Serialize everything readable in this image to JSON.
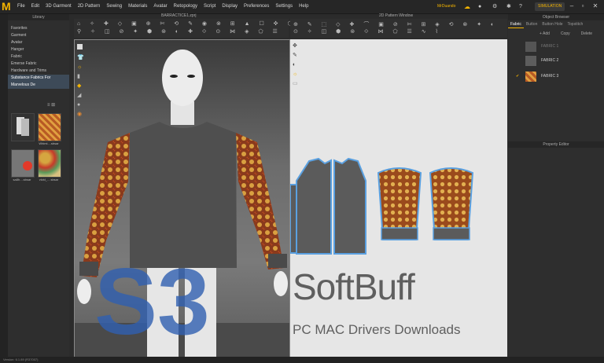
{
  "menu": [
    "File",
    "Edit",
    "3D Garment",
    "2D Pattern",
    "Sewing",
    "Materials",
    "Avatar",
    "Retopology",
    "Script",
    "Display",
    "Preferences",
    "Settings",
    "Help"
  ],
  "menu_right": {
    "user": "MrDuando",
    "mode": "SIMULATION"
  },
  "library": {
    "title": "Library",
    "items": [
      "Favorites",
      "Garment",
      "Avatar",
      "Hanger",
      "Fabric",
      "Emerse Fabric",
      "Hardware and Trims",
      "Substance Fabrics For Marvelous De"
    ],
    "selected_index": 7,
    "thumbs": [
      {
        "label": ""
      },
      {
        "label": "Whimi....sbsar"
      },
      {
        "label": "sa8h....sbsar"
      },
      {
        "label": "vivid_....sbsar"
      }
    ]
  },
  "view3d": {
    "title": "BARRACTICE1.zprj"
  },
  "view2d": {
    "title": "2D Pattern Window"
  },
  "right_panel": {
    "title": "Object Browser",
    "tabs": [
      "Fabric",
      "Button",
      "Button Hole",
      "Topstitch"
    ],
    "add_label": "+ Add",
    "copy_label": "Copy",
    "delete_label": "Delete",
    "fabrics": [
      "FABRIC 1",
      "FABRIC 2",
      "FABRIC 3"
    ],
    "property_title": "Property Editor"
  },
  "watermark": {
    "brand": "SoftBuff",
    "sub": "PC MAC Drivers Downloads"
  },
  "status": "Version: 6.1.89 (R37007)",
  "colors": {
    "accent": "#f4b400",
    "pattern_blue": "#5aa0e0"
  }
}
